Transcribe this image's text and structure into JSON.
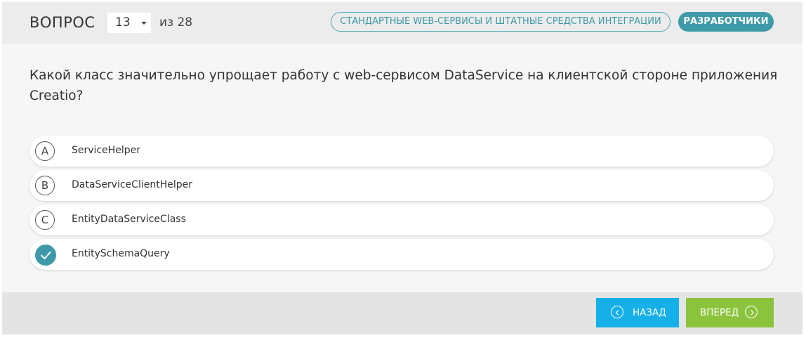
{
  "header": {
    "question_label": "ВОПРОС",
    "current_question": "13",
    "of_total": "из 28",
    "category_tag": "СТАНДАРТНЫЕ WEB-СЕРВИСЫ И ШТАТНЫЕ СРЕДСТВА ИНТЕГРАЦИИ",
    "audience_tag": "РАЗРАБОТЧИКИ"
  },
  "question": {
    "text": "Какой класс значительно упрощает работу с web-сервисом DataService на клиентской стороне приложения Creatio?"
  },
  "answers": [
    {
      "letter": "A",
      "text": "ServiceHelper",
      "selected": false
    },
    {
      "letter": "B",
      "text": "DataServiceClientHelper",
      "selected": false
    },
    {
      "letter": "C",
      "text": "EntityDataServiceClass",
      "selected": false
    },
    {
      "letter": "",
      "text": "EntitySchemaQuery",
      "selected": true,
      "icon": "checkmark-icon"
    }
  ],
  "footer": {
    "back_label": "НАЗАД",
    "next_label": "ВПЕРЕД"
  },
  "colors": {
    "accent": "#3e9aa8",
    "back_button": "#16b0e8",
    "next_button": "#8bc43c"
  }
}
